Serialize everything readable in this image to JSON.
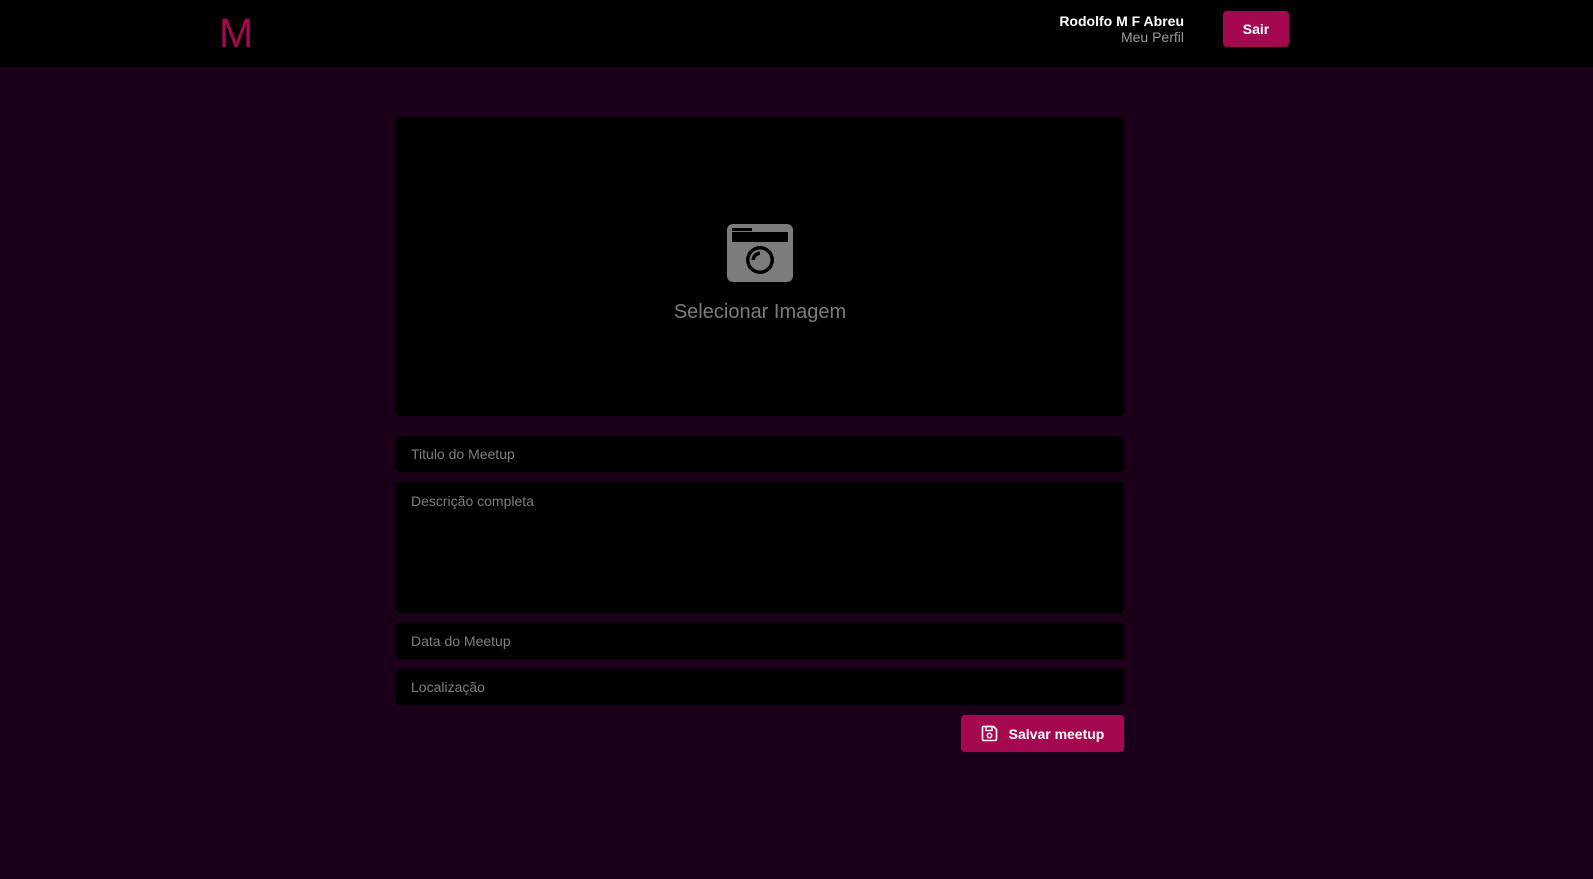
{
  "header": {
    "logo_text": "M",
    "user_name": "Rodolfo M F Abreu",
    "profile_link": "Meu Perfil",
    "logout_label": "Sair"
  },
  "form": {
    "image_picker": {
      "icon": "camera-icon",
      "label": "Selecionar Imagem"
    },
    "title_placeholder": "Titulo do Meetup",
    "description_placeholder": "Descrição completa",
    "date_placeholder": "Data do Meetup",
    "location_placeholder": "Localização",
    "save_icon": "save-icon",
    "save_label": "Salvar meetup"
  },
  "colors": {
    "background": "#190018",
    "topbar": "#010001",
    "accent": "#a4084f",
    "field_bg": "#000000",
    "placeholder": "#7e7e7e"
  }
}
